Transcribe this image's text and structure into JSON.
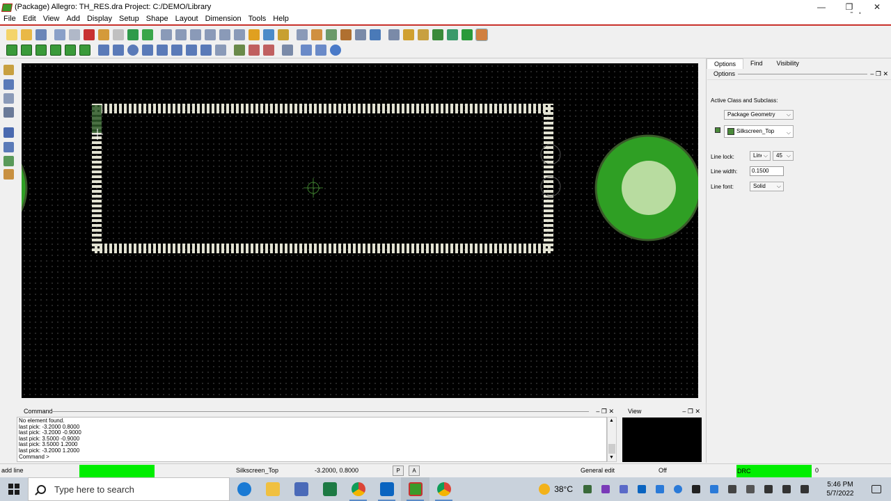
{
  "window": {
    "title": "(Package) Allegro: TH_RES.dra  Project: C:/DEMO/Library",
    "brand": "cādence",
    "minimize": "—",
    "restore": "❐",
    "close": "✕"
  },
  "menu": [
    "File",
    "Edit",
    "View",
    "Add",
    "Display",
    "Setup",
    "Shape",
    "Layout",
    "Dimension",
    "Tools",
    "Help"
  ],
  "colors": {
    "canvas_bg": "#000000",
    "silkscreen": "#e8e8d8",
    "pad_outer": "#33a627",
    "pad_inner": "#b8dca0",
    "drc_green": "#00ee00"
  },
  "right_panel": {
    "tabs": [
      "Options",
      "Find",
      "Visibility"
    ],
    "active_tab": "Options",
    "header": "Options",
    "header_controls": "‒ ❐ ✕",
    "active_class_label": "Active Class and Subclass:",
    "class_value": "Package Geometry",
    "subclass_value": "Silkscreen_Top",
    "line_lock_label": "Line lock:",
    "line_lock_value": "Line",
    "angle_value": "45",
    "line_width_label": "Line width:",
    "line_width_value": "0.1500",
    "line_font_label": "Line font:",
    "line_font_value": "Solid"
  },
  "command": {
    "header": "Command",
    "controls": "‒ ❐ ✕",
    "log": [
      "No element found.",
      "last pick:  -3.2000 0.8000",
      "last pick:  -3.2000 -0.9000",
      "last pick:  3.5000 -0.9000",
      "last pick:  3.5000 1.2000",
      "last pick:  -3.2000 1.2000",
      "Command >"
    ]
  },
  "view_panel": {
    "header": "View",
    "controls": "‒ ❐ ✕"
  },
  "status": {
    "command_name": "add line",
    "subclass": "Silkscreen_Top",
    "coords": "-3.2000, 0.8000",
    "p_button": "P",
    "a_button": "A",
    "mode": "General edit",
    "state": "Off",
    "drc": "DRC",
    "drc_count": "0"
  },
  "taskbar": {
    "search_placeholder": "Type here to search",
    "temperature": "38°C",
    "time": "5:46 PM",
    "date": "5/7/2022"
  }
}
